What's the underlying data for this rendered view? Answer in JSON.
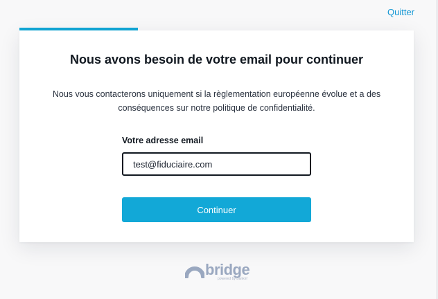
{
  "header": {
    "quit_label": "Quitter"
  },
  "progress": {
    "fraction": 0.3
  },
  "form": {
    "title": "Nous avons besoin de votre email pour continuer",
    "description": "Nous vous contacterons uniquement si la règlementation européenne évolue et a des conséquences sur notre politique de confidentialité.",
    "email_label": "Votre adresse email",
    "email_value": "test@fiduciaire.com",
    "submit_label": "Continuer"
  },
  "footer": {
    "logo_word": "bridge",
    "logo_sub": "powered by Bankin'"
  },
  "colors": {
    "accent": "#12a8d7",
    "link": "#1497d4",
    "logo": "#9aa8c0"
  }
}
